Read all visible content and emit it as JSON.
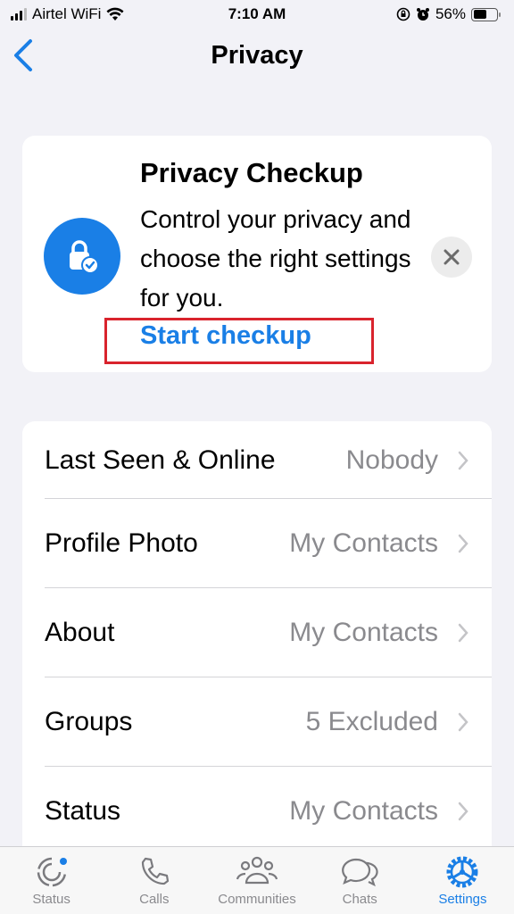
{
  "status_bar": {
    "carrier": "Airtel WiFi",
    "time": "7:10 AM",
    "battery": "56%",
    "battery_level": 0.56
  },
  "nav": {
    "title": "Privacy",
    "back_label": "Back"
  },
  "checkup_card": {
    "title": "Privacy Checkup",
    "description": "Control your privacy and choose the right settings for you.",
    "link": "Start checkup"
  },
  "settings": [
    {
      "label": "Last Seen & Online",
      "value": "Nobody"
    },
    {
      "label": "Profile Photo",
      "value": "My Contacts"
    },
    {
      "label": "About",
      "value": "My Contacts"
    },
    {
      "label": "Groups",
      "value": "5 Excluded"
    },
    {
      "label": "Status",
      "value": "My Contacts"
    }
  ],
  "tabs": [
    {
      "label": "Status",
      "icon": "status-icon",
      "active": false
    },
    {
      "label": "Calls",
      "icon": "phone-icon",
      "active": false
    },
    {
      "label": "Communities",
      "icon": "communities-icon",
      "active": false
    },
    {
      "label": "Chats",
      "icon": "chats-icon",
      "active": false
    },
    {
      "label": "Settings",
      "icon": "gear-icon",
      "active": true
    }
  ],
  "colors": {
    "accent": "#1a7fe6",
    "highlight": "#d9232d",
    "background": "#f2f2f7"
  }
}
